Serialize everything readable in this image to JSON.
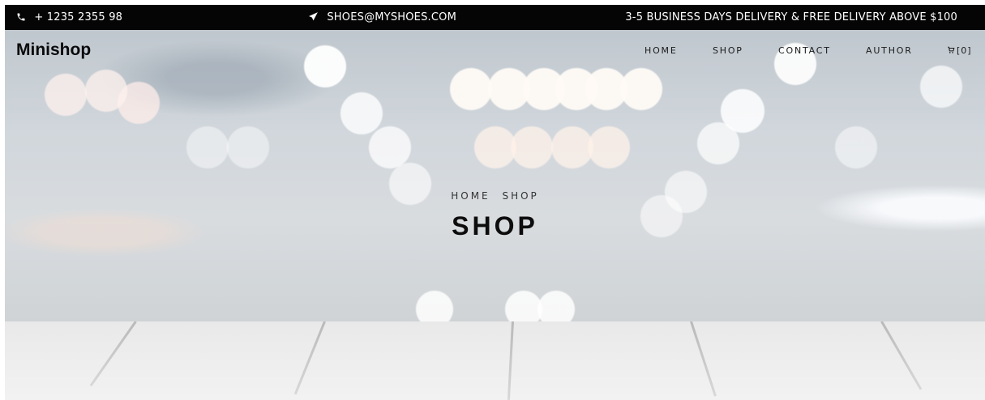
{
  "topbar": {
    "phone": "+ 1235 2355 98",
    "email": "SHOES@MYSHOES.COM",
    "delivery": "3-5 BUSINESS DAYS DELIVERY & FREE DELIVERY ABOVE $100",
    "icons": [
      "phone-icon",
      "paper-plane-icon"
    ]
  },
  "header": {
    "brand": "Minishop",
    "nav": {
      "home": "HOME",
      "shop": "SHOP",
      "contact": "CONTACT",
      "author": "AUTHOR",
      "cart": "[0]"
    }
  },
  "hero": {
    "breadcrumb": [
      "HOME",
      "SHOP"
    ],
    "title": "SHOP"
  },
  "colors": {
    "topbar_bg": "#050505",
    "text_dark": "#0d0d0d"
  }
}
